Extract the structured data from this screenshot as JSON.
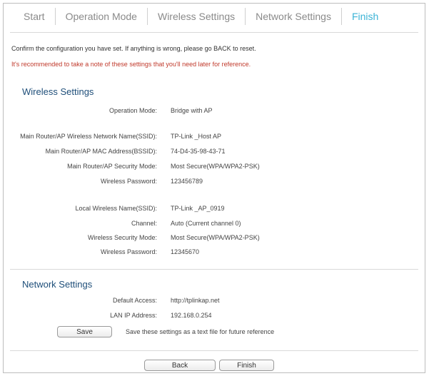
{
  "steps": [
    "Start",
    "Operation Mode",
    "Wireless Settings",
    "Network Settings",
    "Finish"
  ],
  "messages": {
    "confirm": "Confirm the configuration you have set. If anything is wrong, please go BACK to reset.",
    "recommend": "It's recommended to take a note of these settings that you'll need later for reference."
  },
  "wireless": {
    "title": "Wireless Settings",
    "operation_mode": {
      "label": "Operation Mode:",
      "value": "Bridge with AP"
    },
    "main_ssid": {
      "label": "Main Router/AP Wireless Network Name(SSID):",
      "value": "TP-Link _Host AP"
    },
    "main_bssid": {
      "label": "Main Router/AP MAC Address(BSSID):",
      "value": "74-D4-35-98-43-71"
    },
    "main_security": {
      "label": "Main Router/AP Security Mode:",
      "value": "Most Secure(WPA/WPA2-PSK)"
    },
    "main_password": {
      "label": "Wireless Password:",
      "value": "123456789"
    },
    "local_ssid": {
      "label": "Local Wireless Name(SSID):",
      "value": "TP-Link _AP_0919"
    },
    "channel": {
      "label": "Channel:",
      "value": "Auto (Current channel 0)"
    },
    "local_security": {
      "label": "Wireless Security Mode:",
      "value": "Most Secure(WPA/WPA2-PSK)"
    },
    "local_password": {
      "label": "Wireless Password:",
      "value": "12345670"
    }
  },
  "network": {
    "title": "Network Settings",
    "default_access": {
      "label": "Default Access:",
      "value": "http://tplinkap.net"
    },
    "lan_ip": {
      "label": "LAN IP Address:",
      "value": "192.168.0.254"
    }
  },
  "buttons": {
    "save": "Save",
    "save_note": "Save these settings as a text file for future reference",
    "back": "Back",
    "finish": "Finish"
  }
}
